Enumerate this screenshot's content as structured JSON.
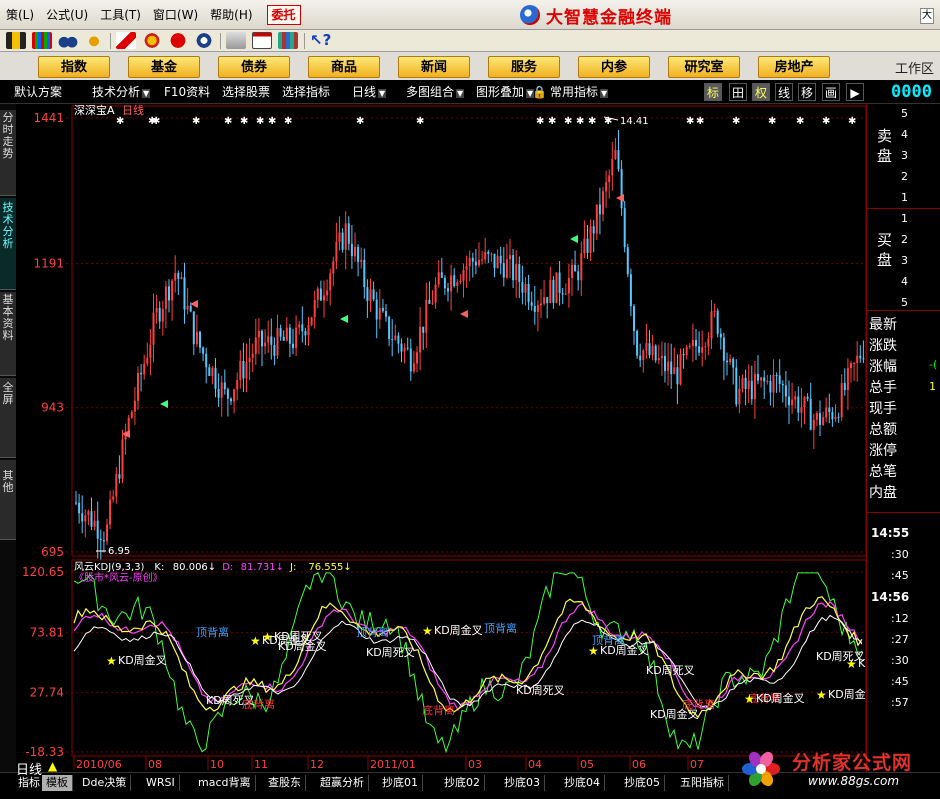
{
  "menu": {
    "items": [
      "策(L)",
      "公式(U)",
      "工具(T)",
      "窗口(W)",
      "帮助(H)"
    ],
    "weituo": "委托",
    "title": "大智慧金融终端",
    "corner": "大"
  },
  "toolbar": {
    "icons": [
      "connect-icon",
      "bars-icon",
      "binoculars-icon",
      "alarm-icon",
      "flag-icon",
      "diamond-icon",
      "no-icon",
      "percent-icon",
      "notepad-icon",
      "layout-icon",
      "books-icon",
      "help-cursor-icon"
    ]
  },
  "nav": {
    "buttons": [
      "指数",
      "基金",
      "债券",
      "商品",
      "新闻",
      "服务",
      "内参",
      "研究室",
      "房地产"
    ],
    "workarea": "工作区"
  },
  "subbar": {
    "items": [
      "默认方案",
      "技术分析",
      "F10资料",
      "选择股票",
      "选择指标",
      "日线",
      "多图组合",
      "图形叠加",
      "常用指标"
    ],
    "vbtns": [
      "标",
      "田",
      "权",
      "线",
      "移",
      "画",
      "▶"
    ],
    "counter": "0000"
  },
  "lefttabs": [
    "分时走势",
    "技术分析",
    "基本资料",
    "全屏",
    "其他"
  ],
  "chart": {
    "stock_name": "深深宝A",
    "period": "日线",
    "price_ticks": [
      "1441",
      "1191",
      "943",
      "695"
    ],
    "high_label": "14.41",
    "low_label": "6.95",
    "indicator_header": {
      "name": "风云KDJ(9,3,3)",
      "k_label": "K:",
      "k_value": "80.006",
      "d_label": "D:",
      "d_value": "81.731",
      "j_label": "J:",
      "j_value": "76.555"
    },
    "indicator_sub": "《股市*风云-原创》",
    "ind_ticks": [
      "120.65",
      "73.81",
      "27.74",
      "-18.33"
    ],
    "date_labels": [
      "2010/06",
      "08",
      "10",
      "11",
      "12",
      "2011/01",
      "03",
      "04",
      "05",
      "06",
      "07"
    ],
    "annotations": [
      {
        "text": "KD周金叉",
        "color": "#ffffff",
        "star": true
      },
      {
        "text": "KD周死叉",
        "color": "#ffffff",
        "star": false
      },
      {
        "text": "底背离",
        "color": "#ff3030",
        "star": false
      },
      {
        "text": "KD周金叉",
        "color": "#ffffff",
        "star": true
      },
      {
        "text": "KD周死叉",
        "color": "#ffffff",
        "star": true
      },
      {
        "text": "KD周金叉",
        "color": "#ffffff",
        "star": false
      },
      {
        "text": "顶背离",
        "color": "#3fa0ff",
        "star": false
      },
      {
        "text": "KD周死叉",
        "color": "#ffffff",
        "star": false
      },
      {
        "text": "顶背离",
        "color": "#3fa0ff",
        "star": false
      },
      {
        "text": "底背离",
        "color": "#ff3030",
        "star": false
      },
      {
        "text": "KD周金叉",
        "color": "#ffffff",
        "star": true
      },
      {
        "text": "顶背离",
        "color": "#3fa0ff",
        "star": false
      },
      {
        "text": "KD周死叉",
        "color": "#ffffff",
        "star": false
      },
      {
        "text": "顶背离",
        "color": "#3fa0ff",
        "star": false
      },
      {
        "text": "KD周金叉",
        "color": "#ffffff",
        "star": true
      },
      {
        "text": "KD周死叉",
        "color": "#ffffff",
        "star": false
      },
      {
        "text": "KD周金叉",
        "color": "#ffffff",
        "star": false
      },
      {
        "text": "底背离",
        "color": "#ff3030",
        "star": false
      },
      {
        "text": "底背离",
        "color": "#ff3030",
        "star": false
      },
      {
        "text": "KD周金叉",
        "color": "#ffffff",
        "star": true
      },
      {
        "text": "KD周死叉",
        "color": "#ffffff",
        "star": false
      },
      {
        "text": "KD周金叉",
        "color": "#ffffff",
        "star": true
      },
      {
        "text": "KD周",
        "color": "#ffffff",
        "star": true
      }
    ]
  },
  "chart_data": {
    "type": "candlestick",
    "title": "深深宝A",
    "period": "日线",
    "ylim": [
      695,
      1441
    ],
    "yticks": [
      1441,
      1191,
      943,
      695
    ],
    "high": 14.41,
    "low": 6.95,
    "indicator": {
      "name": "风云KDJ(9,3,3)",
      "K": 80.006,
      "D": 81.731,
      "J": 76.555,
      "ylim": [
        -18.33,
        120.65
      ],
      "yticks": [
        120.65,
        73.81,
        27.74,
        -18.33
      ]
    },
    "x_labels": [
      "2010/06",
      "08",
      "10",
      "11",
      "12",
      "2011/01",
      "03",
      "04",
      "05",
      "06",
      "07"
    ],
    "colors": {
      "up": "#ff4040",
      "down": "#55c8ff",
      "K": "#ffffff",
      "D": "#ff40ff",
      "J": "#ffff40",
      "J2": "#40ff40"
    }
  },
  "right": {
    "sell_label": "卖盘",
    "buy_label": "买盘",
    "sell_levels": [
      "5",
      "4",
      "3",
      "2",
      "1"
    ],
    "buy_levels": [
      "1",
      "2",
      "3",
      "4",
      "5"
    ],
    "fields": [
      "最新",
      "涨跌",
      "涨幅",
      "总手",
      "现手",
      "总额",
      "涨停",
      "总笔",
      "内盘"
    ],
    "side_marks": [
      "-(",
      "1"
    ],
    "times": [
      {
        "t": "14:55",
        "m": [
          ":30",
          ":45"
        ]
      },
      {
        "t": "14:56",
        "m": [
          ":12",
          ":27",
          ":30",
          ":45",
          ":57"
        ]
      }
    ]
  },
  "bottom": {
    "period": "日线",
    "tabs": [
      "指标",
      "模板",
      "Dde决策",
      "WRSI",
      "macd背离",
      "查股东",
      "超赢分析",
      "抄底01",
      "抄底02",
      "抄底03",
      "抄底04",
      "抄底05",
      "五阳指标"
    ]
  },
  "watermark": {
    "text": "分析家公式网",
    "url": "www.88gs.com"
  }
}
